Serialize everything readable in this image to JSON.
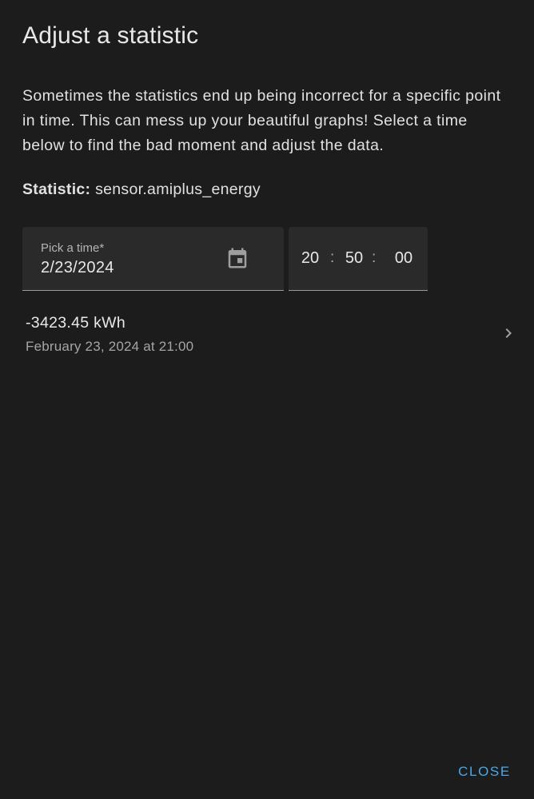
{
  "dialog": {
    "title": "Adjust a statistic",
    "description": "Sometimes the statistics end up being incorrect for a specific point in time. This can mess up your beautiful graphs! Select a time below to find the bad moment and adjust the data.",
    "statistic_label": "Statistic:",
    "statistic_value": "sensor.amiplus_energy"
  },
  "date_picker": {
    "label": "Pick a time*",
    "value": "2/23/2024",
    "icon": "calendar-icon"
  },
  "time_picker": {
    "hours": "20",
    "minutes": "50",
    "seconds": "00",
    "separator": ":"
  },
  "result": {
    "value": "-3423.45 kWh",
    "timestamp": "February 23, 2024 at 21:00",
    "icon": "chevron-right-icon"
  },
  "actions": {
    "close_label": "CLOSE"
  },
  "colors": {
    "background": "#1c1c1c",
    "field": "#2a2a2a",
    "accent": "#4aa7ea"
  }
}
